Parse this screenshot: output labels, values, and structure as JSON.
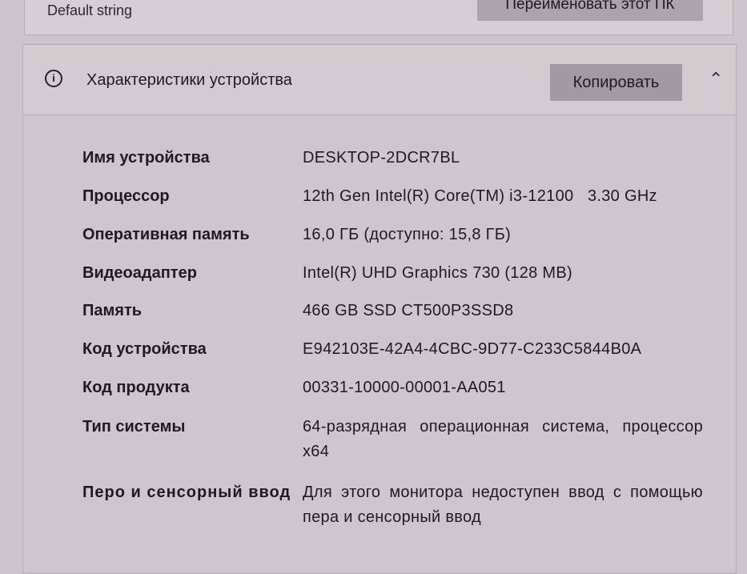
{
  "top_card": {
    "subtitle": "Default string",
    "rename_button": "Переименовать этот ПК"
  },
  "specs": {
    "title": "Характеристики устройства",
    "copy_button": "Копировать",
    "info_icon": "info-icon",
    "collapse_icon": "chevron-up-icon",
    "rows": [
      {
        "label": "Имя устройства",
        "value": "DESKTOP-2DCR7BL"
      },
      {
        "label": "Процессор",
        "value": "12th Gen Intel(R) Core(TM) i3-12100   3.30 GHz"
      },
      {
        "label": "Оперативная память",
        "value": "16,0 ГБ (доступно: 15,8 ГБ)"
      },
      {
        "label": "Видеоадаптер",
        "value": "Intel(R) UHD Graphics 730 (128 MB)"
      },
      {
        "label": "Память",
        "value": "466 GB SSD CT500P3SSD8"
      },
      {
        "label": "Код устройства",
        "value": "E942103E-42A4-4CBC-9D77-C233C5844B0A"
      },
      {
        "label": "Код продукта",
        "value": "00331-10000-00001-AA051"
      },
      {
        "label": "Тип системы",
        "value": "64-разрядная операционная система, процессор x64"
      },
      {
        "label": "Перо и сенсорный ввод",
        "value": "Для этого монитора недоступен ввод с помощью пера и сенсорный ввод"
      }
    ]
  }
}
